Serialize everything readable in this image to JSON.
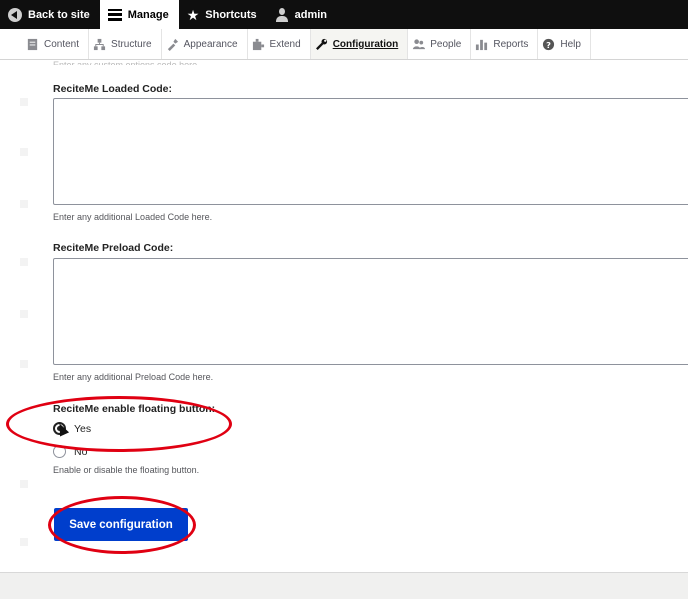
{
  "toolbar": {
    "back_label": "Back to site",
    "manage_label": "Manage",
    "shortcuts_label": "Shortcuts",
    "user_label": "admin"
  },
  "tray": {
    "items": [
      {
        "label": "Content",
        "icon": "content-icon"
      },
      {
        "label": "Structure",
        "icon": "structure-icon"
      },
      {
        "label": "Appearance",
        "icon": "appearance-icon"
      },
      {
        "label": "Extend",
        "icon": "extend-icon"
      },
      {
        "label": "Configuration",
        "icon": "wrench-icon",
        "active": true
      },
      {
        "label": "People",
        "icon": "people-icon"
      },
      {
        "label": "Reports",
        "icon": "reports-icon"
      },
      {
        "label": "Help",
        "icon": "help-icon"
      }
    ]
  },
  "form": {
    "top_hint": "Enter any custom options code here.",
    "loaded_label": "ReciteMe Loaded Code:",
    "loaded_desc": "Enter any additional Loaded Code here.",
    "preload_label": "ReciteMe Preload Code:",
    "preload_desc": "Enter any additional Preload Code here.",
    "floating_label": "ReciteMe enable floating button:",
    "yes_label": "Yes",
    "no_label": "No",
    "floating_desc": "Enable or disable the floating button.",
    "save_label": "Save configuration"
  },
  "colors": {
    "primary_button": "#003ecc",
    "annotation": "#e00012",
    "toolbar": "#0f0f0f"
  }
}
